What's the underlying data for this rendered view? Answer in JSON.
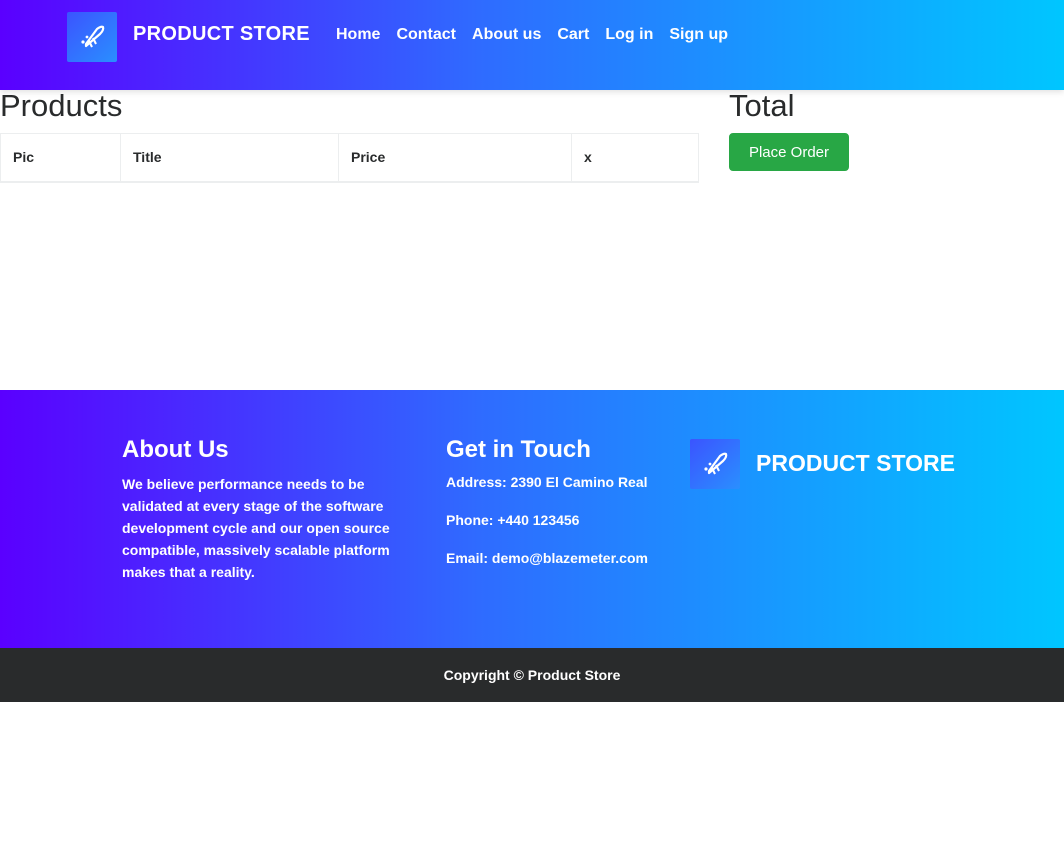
{
  "navbar": {
    "brand": "PRODUCT STORE",
    "links": [
      "Home",
      "Contact",
      "About us",
      "Cart",
      "Log in",
      "Sign up"
    ]
  },
  "main": {
    "products_title": "Products",
    "table_headers": [
      "Pic",
      "Title",
      "Price",
      "x"
    ],
    "total_title": "Total",
    "place_order_label": "Place Order"
  },
  "footer": {
    "about_title": "About Us",
    "about_text": "We believe performance needs to be validated at every stage of the software development cycle and our open source compatible, massively scalable platform makes that a reality.",
    "touch_title": "Get in Touch",
    "address": "Address: 2390 El Camino Real",
    "phone": "Phone: +440 123456",
    "email": "Email: demo@blazemeter.com",
    "brand": "PRODUCT STORE",
    "copyright": "Copyright © Product Store"
  },
  "colors": {
    "gradient_start": "#5a00ff",
    "gradient_end": "#00c6ff",
    "success": "#28a745",
    "dark_bar": "#292b2c"
  },
  "icons": [
    "rocket-logo-icon"
  ]
}
